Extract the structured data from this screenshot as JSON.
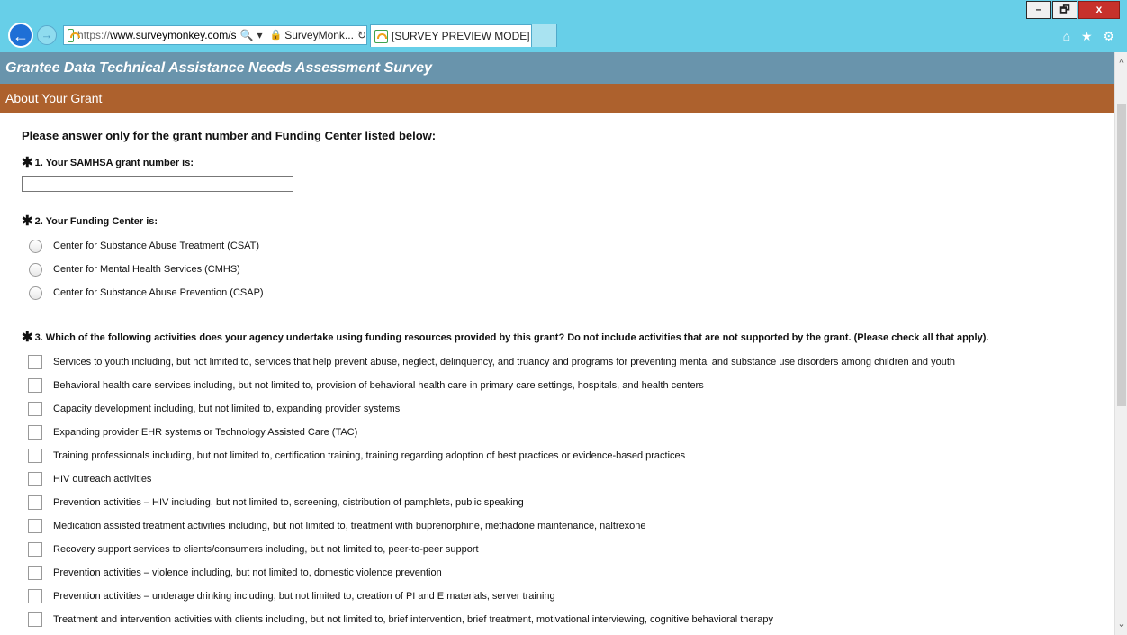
{
  "browser": {
    "url_scheme": "https://",
    "url_host": "www.surveymonkey.com/s",
    "search_icon": "🔍",
    "site_label": "SurveyMonk...",
    "refresh_icon": "↻",
    "tab_title": "[SURVEY PREVIEW MODE] ...",
    "tab_close": "×",
    "win_minimize": "–",
    "win_restore": "🗗",
    "win_close": "x",
    "back_icon": "←",
    "forward_icon": "→",
    "right_icons": "⌂ ★ ⚙"
  },
  "survey": {
    "title": "Grantee Data Technical Assistance Needs Assessment Survey",
    "section": "About Your Grant",
    "intro": "Please answer only for the grant number and Funding Center listed below:"
  },
  "q1": {
    "star": "✱",
    "label": "1. Your SAMHSA grant number is:",
    "value": ""
  },
  "q2": {
    "star": "✱",
    "label": "2. Your Funding Center is:",
    "options": [
      "Center for Substance Abuse Treatment (CSAT)",
      "Center for Mental Health Services (CMHS)",
      "Center for Substance Abuse Prevention (CSAP)"
    ]
  },
  "q3": {
    "star": "✱",
    "label": "3. Which of the following activities does your agency undertake using funding resources provided by this grant? Do not include activities that are not supported by the grant. (Please check all that apply).",
    "options": [
      "Services to youth including, but not limited to, services that help prevent abuse, neglect, delinquency, and truancy and programs for preventing mental and substance use disorders among children and youth",
      "Behavioral health care services including, but not limited to, provision of behavioral health care in primary care settings, hospitals, and health centers",
      "Capacity development including, but not limited to, expanding provider systems",
      "Expanding provider EHR systems or Technology Assisted Care (TAC)",
      "Training professionals including, but not limited to, certification training, training regarding adoption of best practices or evidence-based practices",
      "HIV outreach activities",
      "Prevention activities – HIV including, but not limited to, screening, distribution of pamphlets, public speaking",
      "Medication assisted treatment activities including, but not limited to, treatment with buprenorphine, methadone maintenance, naltrexone",
      "Recovery support services to clients/consumers including, but not limited to, peer-to-peer support",
      "Prevention activities – violence including, but not limited to, domestic violence prevention",
      "Prevention activities – underage drinking including, but not limited to, creation of PI and E materials, server training",
      "Treatment and intervention activities with clients including, but not limited to, brief intervention, brief treatment, motivational interviewing, cognitive behavioral therapy"
    ]
  },
  "scroll": {
    "up": "^",
    "down": "⌄"
  }
}
